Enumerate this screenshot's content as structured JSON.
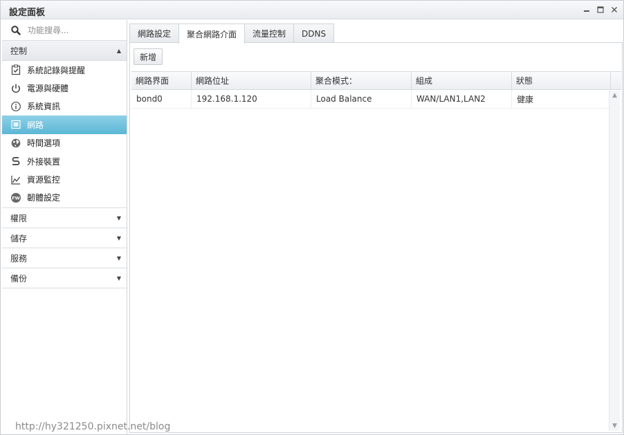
{
  "window": {
    "title": "設定面板"
  },
  "sidebar": {
    "search_placeholder": "功能搜尋...",
    "sections": [
      {
        "label": "控制",
        "expanded": true,
        "items": [
          {
            "label": "系統記錄與提醒",
            "icon": "clipboard-check-icon"
          },
          {
            "label": "電源與硬體",
            "icon": "power-icon"
          },
          {
            "label": "系統資訊",
            "icon": "info-icon"
          },
          {
            "label": "網路",
            "icon": "network-icon",
            "active": true
          },
          {
            "label": "時間選項",
            "icon": "globe-clock-icon"
          },
          {
            "label": "外接裝置",
            "icon": "usb-icon"
          },
          {
            "label": "資源監控",
            "icon": "line-chart-icon"
          },
          {
            "label": "韌體設定",
            "icon": "firmware-icon"
          }
        ]
      },
      {
        "label": "權限",
        "expanded": false
      },
      {
        "label": "儲存",
        "expanded": false
      },
      {
        "label": "服務",
        "expanded": false
      },
      {
        "label": "備份",
        "expanded": false
      }
    ]
  },
  "tabs": [
    {
      "label": "網路設定"
    },
    {
      "label": "聚合網路介面",
      "active": true
    },
    {
      "label": "流量控制"
    },
    {
      "label": "DDNS"
    }
  ],
  "toolbar": {
    "add_label": "新增"
  },
  "table": {
    "columns": [
      "網路界面",
      "網路位址",
      "聚合模式：",
      "組成",
      "狀態"
    ],
    "rows": [
      [
        "bond0",
        "192.168.1.120",
        "Load Balance",
        "WAN/LAN1,LAN2",
        "健康"
      ]
    ]
  },
  "watermark": "http://hy321250.pixnet.net/blog",
  "colors": {
    "active_item": "#5bb7d6",
    "border": "#cfd4d9"
  }
}
